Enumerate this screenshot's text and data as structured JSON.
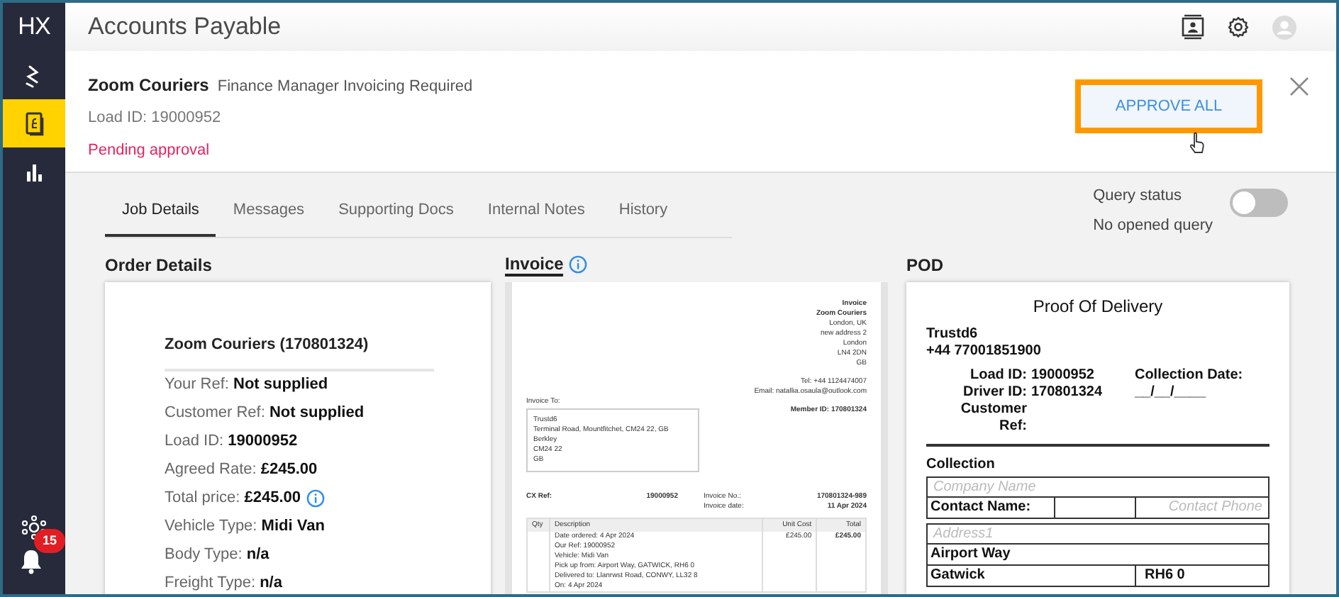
{
  "app": {
    "logo": "HX",
    "title": "Accounts Payable"
  },
  "sidebar": {
    "items": [
      {
        "kind": "route",
        "selected": false
      },
      {
        "kind": "invoice",
        "selected": true
      },
      {
        "kind": "chart",
        "selected": false
      }
    ],
    "notification_count": "15"
  },
  "job": {
    "company": "Zoom Couriers",
    "status_label": "Finance Manager Invoicing Required",
    "load_id": "Load ID: 19000952",
    "approval": "Pending approval",
    "approve_button": "APPROVE ALL",
    "approve_highlighted": true
  },
  "tabs": [
    {
      "label": "Job Details",
      "selected": true
    },
    {
      "label": "Messages",
      "selected": false
    },
    {
      "label": "Supporting Docs",
      "selected": false
    },
    {
      "label": "Internal Notes",
      "selected": false
    },
    {
      "label": "History",
      "selected": false
    }
  ],
  "query": {
    "label": "Query status",
    "value": "No opened query",
    "on": false
  },
  "sections": {
    "order_details": "Order Details",
    "invoice": "Invoice",
    "pod": "POD"
  },
  "order": {
    "heading": "Zoom Couriers (170801324)",
    "fields": [
      {
        "label": "Your Ref:",
        "value": "Not supplied",
        "info": false
      },
      {
        "label": "Customer Ref:",
        "value": "Not supplied",
        "info": false
      },
      {
        "label": "Load ID:",
        "value": "19000952",
        "info": false
      },
      {
        "label": "Agreed Rate:",
        "value": "£245.00",
        "info": false
      },
      {
        "label": "Total price:",
        "value": "£245.00",
        "info": true
      },
      {
        "label": "Vehicle Type:",
        "value": "Midi Van",
        "info": false
      },
      {
        "label": "Body Type:",
        "value": "n/a",
        "info": false
      },
      {
        "label": "Freight Type:",
        "value": "n/a",
        "info": false
      }
    ]
  },
  "invoice": {
    "supplier": [
      {
        "text": "Invoice",
        "bold": true
      },
      {
        "text": "Zoom Couriers",
        "bold": true
      },
      {
        "text": "London, UK",
        "bold": false
      },
      {
        "text": "new address 2",
        "bold": false
      },
      {
        "text": "London",
        "bold": false
      },
      {
        "text": "LN4 2DN",
        "bold": false
      },
      {
        "text": "GB",
        "bold": false
      }
    ],
    "contact": [
      "Tel: +44 1124474007",
      "Email: natallia.osaula@outlook.com"
    ],
    "invoice_to_label": "Invoice To:",
    "invoice_to": [
      "Trustd6",
      "Terminal Road, Mountfitchet, CM24 22, GB",
      "Berkley",
      "CM24 22",
      "GB"
    ],
    "member_id": "Member ID: 170801324",
    "refs": [
      {
        "label": "CX Ref:",
        "value": "19000952"
      }
    ],
    "numbers": [
      {
        "label": "Invoice No.:",
        "value": "170801324-989"
      },
      {
        "label": "Invoice date:",
        "value": "11 Apr 2024"
      }
    ],
    "columns": [
      "Qty",
      "Description",
      "Unit Cost",
      "Total"
    ],
    "rows": [
      {
        "qty": "",
        "description": [
          "Date ordered: 4 Apr 2024",
          "Our Ref: 19000952",
          "Vehicle: Midi Van",
          "Pick up from: Airport Way, GATWICK, RH6 0",
          "Delivered to: Llanrwst Road, CONWY, LL32 8",
          "On: 4 Apr 2024"
        ],
        "unit_cost": "£245.00",
        "total": "£245.00"
      }
    ]
  },
  "pod": {
    "title": "Proof Of Delivery",
    "name": "Trustd6",
    "phone": "+44 77001851900",
    "ids": [
      {
        "label": "Load ID:",
        "value": "19000952",
        "extra": "Collection Date:"
      },
      {
        "label": "Driver ID:",
        "value": "170801324",
        "extra": "__/__/____"
      },
      {
        "label": "Customer Ref:"
      }
    ],
    "collection": {
      "heading": "Collection",
      "company_name_prompt": "Company Name",
      "contact_label": "Contact Name:",
      "contact_phone_prompt": "Contact Phone",
      "address_prompt": "Address1",
      "address": "Airport Way",
      "town": "Gatwick",
      "postcode": "RH6 0"
    }
  }
}
